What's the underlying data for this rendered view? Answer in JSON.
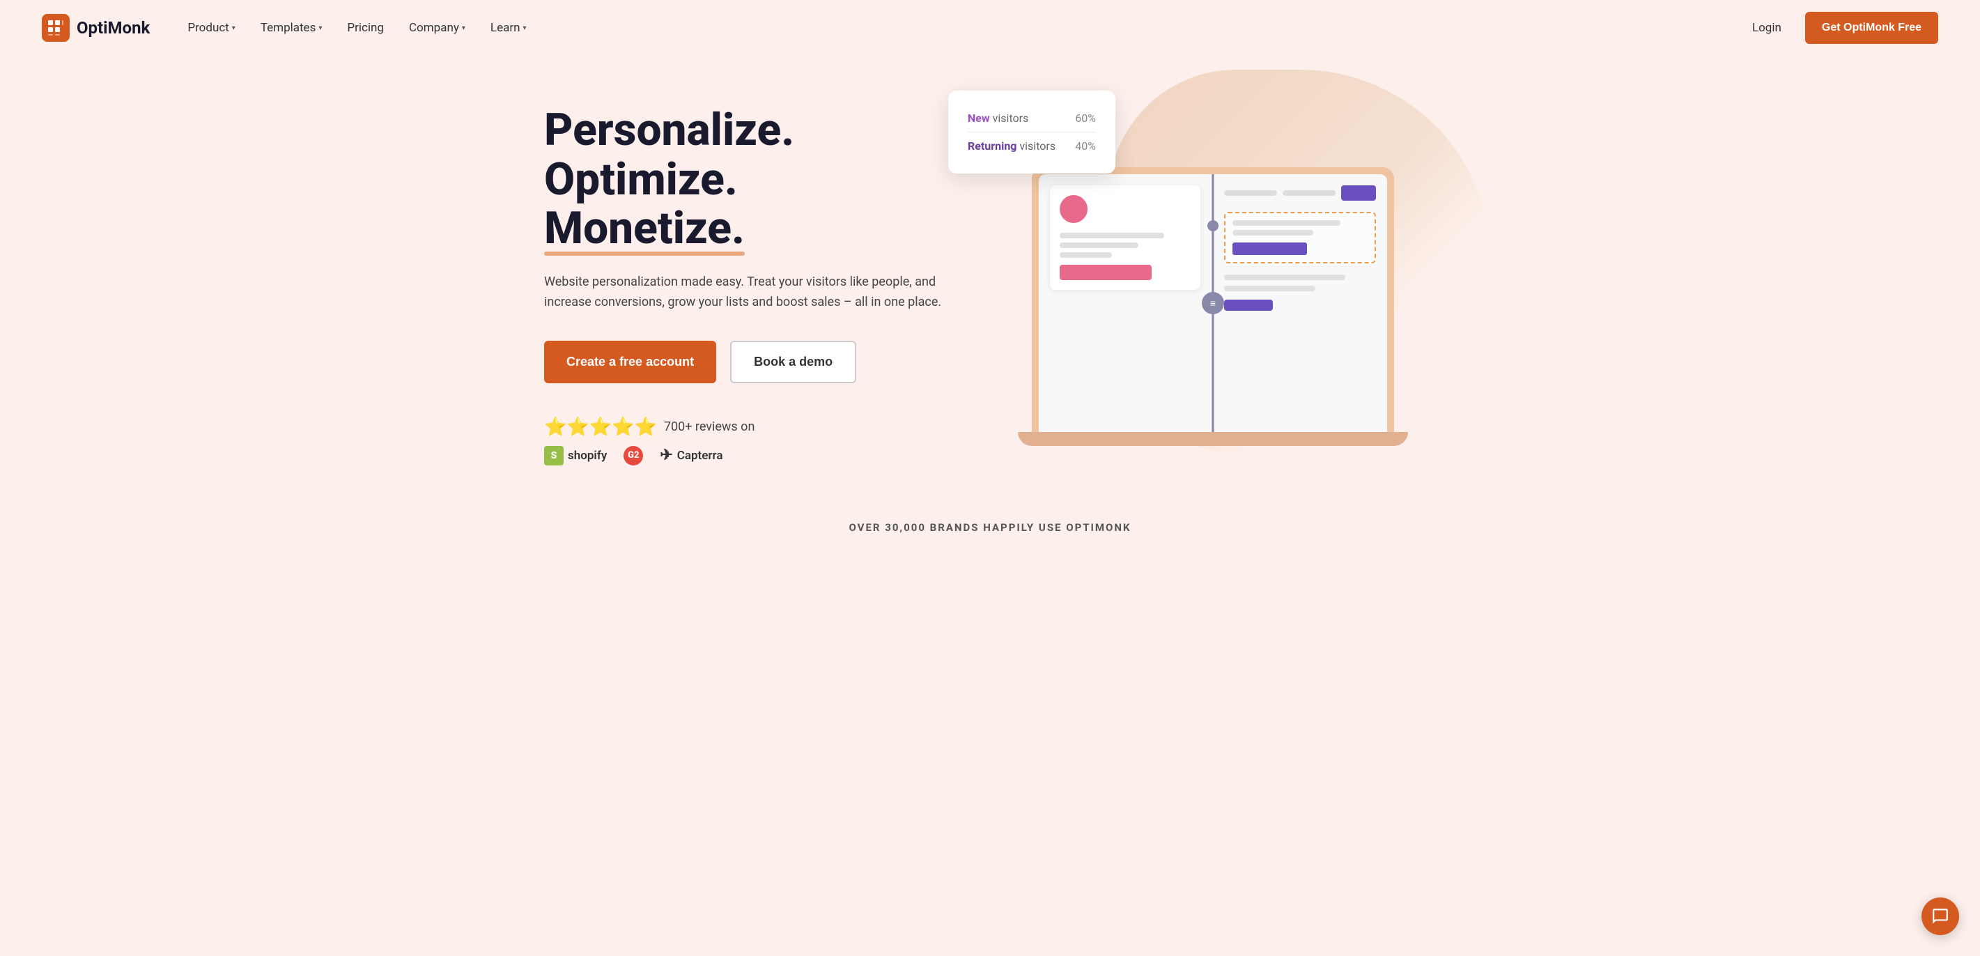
{
  "brand": {
    "name": "OptiMonk",
    "logo_alt": "OptiMonk logo"
  },
  "nav": {
    "product_label": "Product",
    "templates_label": "Templates",
    "pricing_label": "Pricing",
    "company_label": "Company",
    "learn_label": "Learn",
    "login_label": "Login",
    "cta_label": "Get OptiMonk Free"
  },
  "hero": {
    "headline_line1": "Personalize. Optimize.",
    "headline_line2": "Monetize.",
    "subtext": "Website personalization made easy. Treat your visitors like people, and increase conversions, grow your lists and boost sales – all in one place.",
    "cta_primary": "Create a free account",
    "cta_secondary": "Book a demo",
    "stars": "⭐⭐⭐⭐⭐",
    "reviews_text": "700+ reviews on",
    "platforms": [
      "Shopify",
      "G2",
      "Capterra"
    ]
  },
  "floating_card": {
    "new_label": "New",
    "visitors_label": " visitors",
    "new_pct": "60%",
    "returning_label": "Returning",
    "returning_visitors_label": " visitors",
    "returning_pct": "40%"
  },
  "bottom_banner": {
    "text": "OVER 30,000 BRANDS HAPPILY USE OPTIMONK"
  }
}
